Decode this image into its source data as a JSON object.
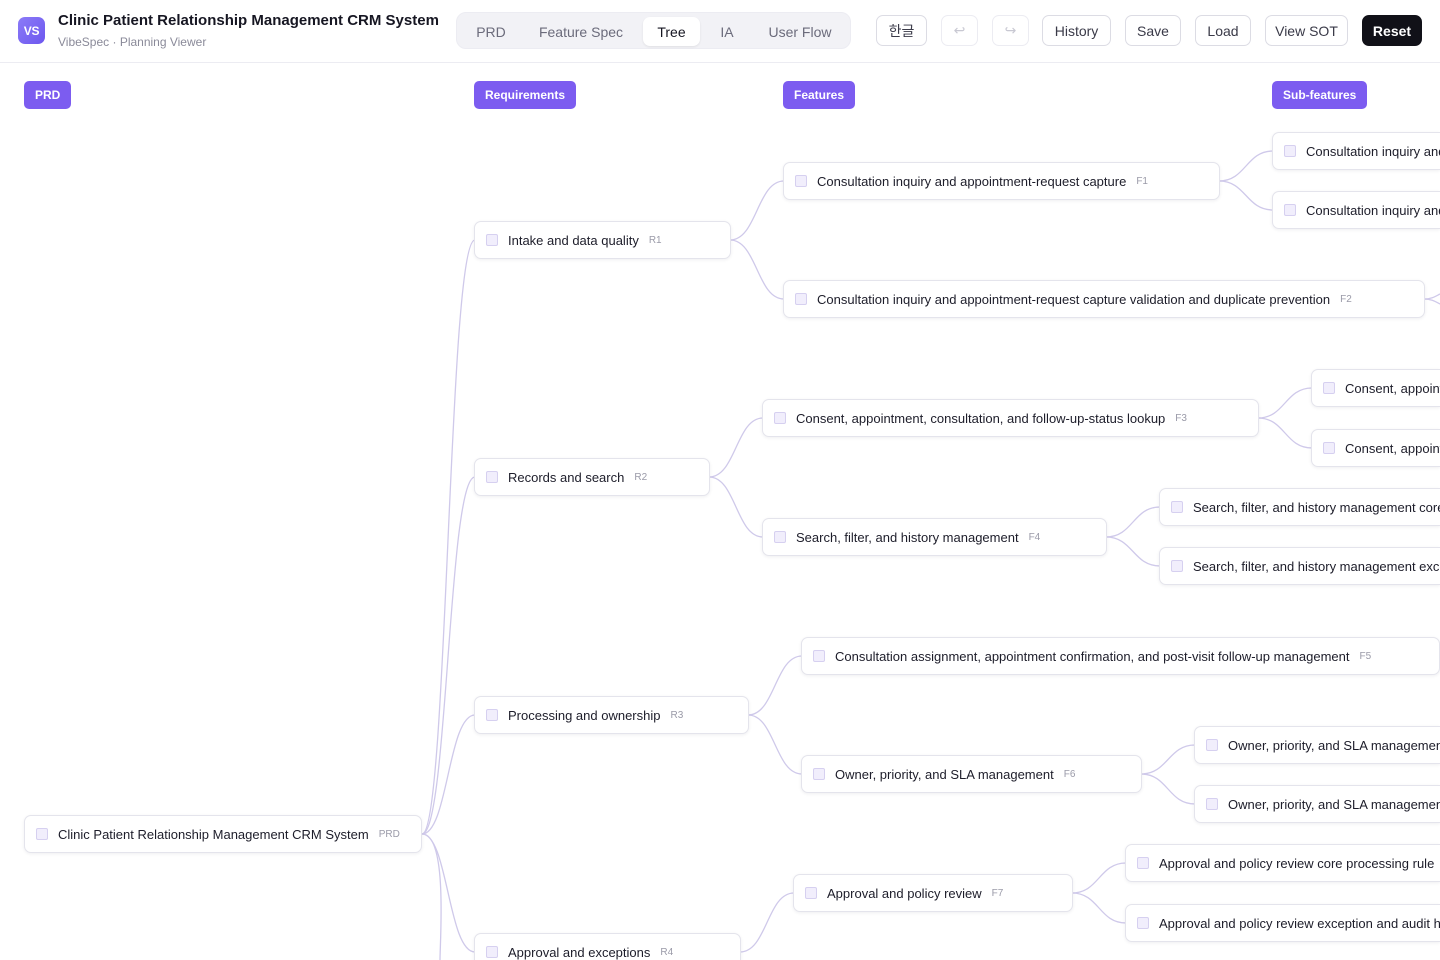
{
  "header": {
    "logo_text": "VS",
    "title": "Clinic Patient Relationship Management CRM System",
    "subtitle": "VibeSpec · Planning Viewer",
    "tabs": [
      {
        "label": "PRD",
        "active": false
      },
      {
        "label": "Feature Spec",
        "active": false
      },
      {
        "label": "Tree",
        "active": true
      },
      {
        "label": "IA",
        "active": false
      },
      {
        "label": "User Flow",
        "active": false
      }
    ],
    "language_label": "한글",
    "undo_icon": "↩",
    "redo_icon": "↪",
    "history_label": "History",
    "save_label": "Save",
    "load_label": "Load",
    "view_sot_label": "View SOT",
    "reset_label": "Reset"
  },
  "columns": {
    "prd": "PRD",
    "requirements": "Requirements",
    "features": "Features",
    "subfeatures": "Sub-features"
  },
  "colors": {
    "accent": "#7c5cf0",
    "link": "#cfc9ea",
    "dark_button": "#111118"
  },
  "tree": {
    "root": {
      "label": "Clinic Patient Relationship Management CRM System",
      "code": "PRD"
    },
    "requirements": [
      {
        "label": "Intake and data quality",
        "code": "R1"
      },
      {
        "label": "Records and search",
        "code": "R2"
      },
      {
        "label": "Processing and ownership",
        "code": "R3"
      },
      {
        "label": "Approval and exceptions",
        "code": "R4"
      }
    ],
    "features": [
      {
        "label": "Consultation inquiry and appointment-request capture",
        "code": "F1"
      },
      {
        "label": "Consultation inquiry and appointment-request capture validation and duplicate prevention",
        "code": "F2"
      },
      {
        "label": "Consent, appointment, consultation, and follow-up-status lookup",
        "code": "F3"
      },
      {
        "label": "Search, filter, and history management",
        "code": "F4"
      },
      {
        "label": "Consultation assignment, appointment confirmation, and post-visit follow-up management",
        "code": "F5"
      },
      {
        "label": "Owner, priority, and SLA management",
        "code": "F6"
      },
      {
        "label": "Approval and policy review",
        "code": "F7"
      }
    ],
    "subfeatures": [
      {
        "label": "Consultation inquiry and appointment-request capture core processing rule"
      },
      {
        "label": "Consultation inquiry and appointment-request capture exception and audit handling"
      },
      {
        "label": "Consent, appointment, consultation, and follow-up-status lookup core processing rule"
      },
      {
        "label": "Consent, appointment, consultation, and follow-up-status lookup exception and audit handling"
      },
      {
        "label": "Search, filter, and history management core processing rule"
      },
      {
        "label": "Search, filter, and history management exception and audit handling"
      },
      {
        "label": "Owner, priority, and SLA management core processing rule"
      },
      {
        "label": "Owner, priority, and SLA management exception and audit handling"
      },
      {
        "label": "Approval and policy review core processing rule"
      },
      {
        "label": "Approval and policy review exception and audit handling"
      }
    ]
  }
}
